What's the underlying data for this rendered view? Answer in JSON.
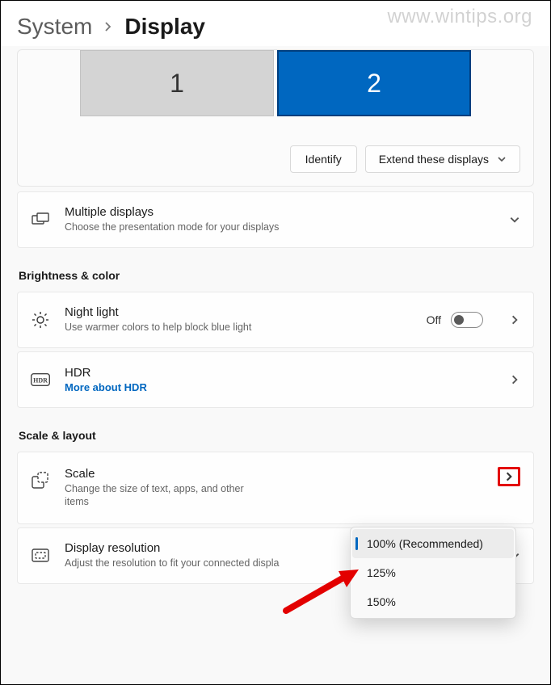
{
  "watermark": "www.wintips.org",
  "breadcrumb": {
    "parent": "System",
    "current": "Display"
  },
  "monitors": {
    "m1": "1",
    "m2": "2",
    "identify": "Identify",
    "extend": "Extend these displays"
  },
  "multiple": {
    "title": "Multiple displays",
    "sub": "Choose the presentation mode for your displays"
  },
  "sections": {
    "brightness": "Brightness & color",
    "scale": "Scale & layout"
  },
  "night": {
    "title": "Night light",
    "sub": "Use warmer colors to help block blue light",
    "state": "Off"
  },
  "hdr": {
    "title": "HDR",
    "link": "More about HDR"
  },
  "scaleRow": {
    "title": "Scale",
    "sub": "Change the size of text, apps, and other items"
  },
  "resolution": {
    "title": "Display resolution",
    "sub": "Adjust the resolution to fit your connected displa"
  },
  "scaleOptions": {
    "o1": "100% (Recommended)",
    "o2": "125%",
    "o3": "150%"
  }
}
